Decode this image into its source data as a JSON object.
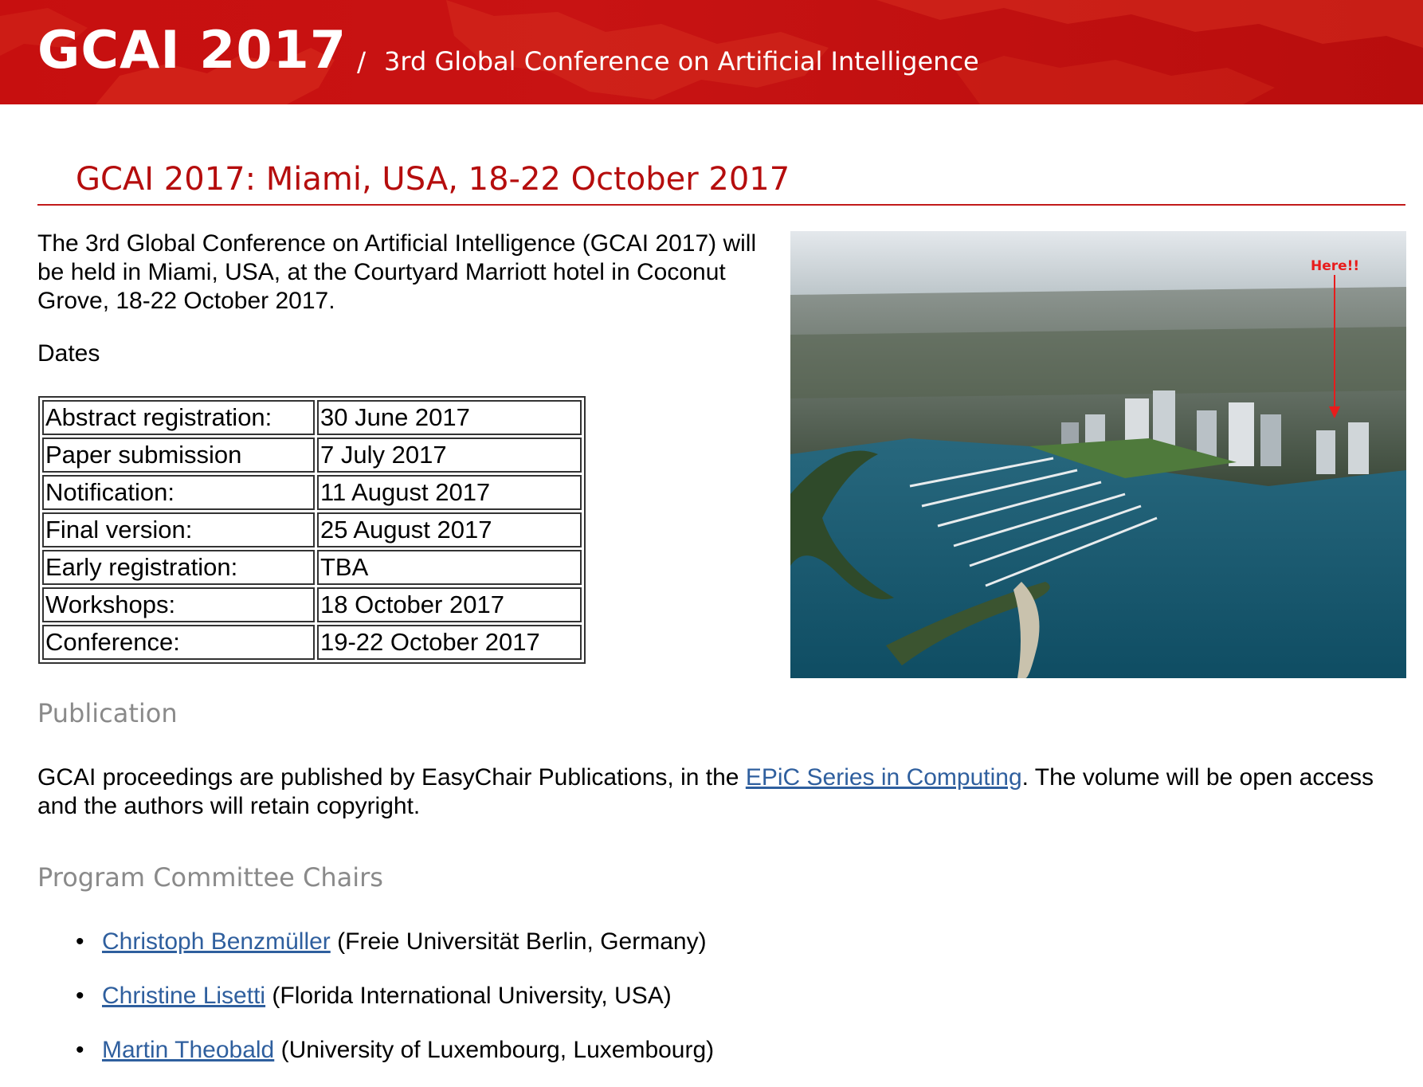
{
  "header": {
    "title": "GCAI 2017",
    "separator": "/",
    "subtitle": "3rd Global Conference on Artificial Intelligence"
  },
  "main": {
    "heading": "GCAI 2017: Miami, USA, 18-22 October 2017",
    "intro": "The 3rd Global Conference on Artificial Intelligence (GCAI 2017) will be held in Miami, USA, at the Courtyard Marriott hotel in Coconut Grove, 18-22 October 2017.",
    "dates_label": "Dates",
    "dates": [
      {
        "label": "Abstract registration:",
        "value": "30 June 2017"
      },
      {
        "label": "Paper submission",
        "value": "7 July 2017"
      },
      {
        "label": "Notification:",
        "value": "11 August 2017"
      },
      {
        "label": "Final version:",
        "value": "25 August 2017"
      },
      {
        "label": "Early registration:",
        "value": "TBA"
      },
      {
        "label": "Workshops:",
        "value": "18 October 2017"
      },
      {
        "label": "Conference:",
        "value": "19-22 October 2017"
      }
    ],
    "photo": {
      "annotation": "Here!!"
    },
    "publication": {
      "heading": "Publication",
      "text_before": "GCAI proceedings are published by EasyChair Publications, in the ",
      "link_text": "EPiC Series in Computing",
      "text_after": ". The volume will be open access and the authors will retain copyright."
    },
    "program_committee": {
      "heading": "Program Committee Chairs",
      "chairs": [
        {
          "name": "Christoph Benzmüller",
          "affiliation": " (Freie Universität Berlin, Germany)"
        },
        {
          "name": "Christine Lisetti",
          "affiliation": " (Florida International University, USA)"
        },
        {
          "name": "Martin Theobald",
          "affiliation": " (University of Luxembourg, Luxembourg)"
        }
      ]
    }
  },
  "colors": {
    "banner_red": "#c70f0f",
    "heading_red": "#b50d0d",
    "section_gray": "#8a8a8a",
    "link_blue": "#2f5f9e"
  }
}
